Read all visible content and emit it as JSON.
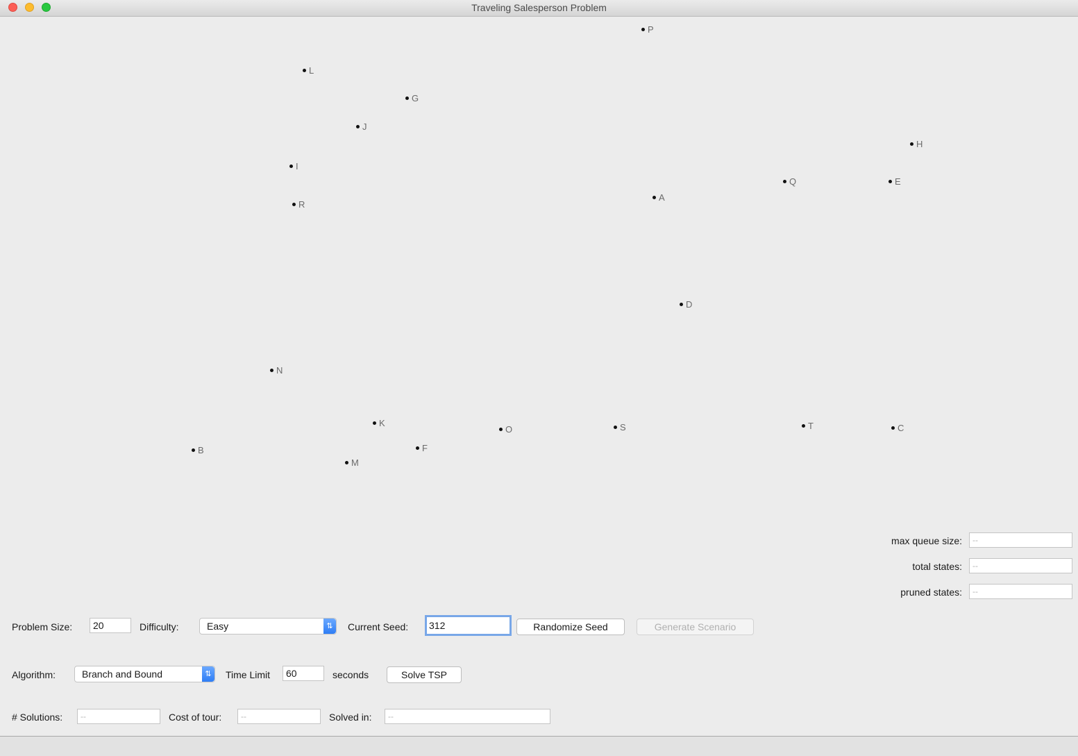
{
  "window": {
    "title": "Traveling Salesperson Problem"
  },
  "cities": [
    {
      "label": "P"
    },
    {
      "label": "L"
    },
    {
      "label": "G"
    },
    {
      "label": "J"
    },
    {
      "label": "H"
    },
    {
      "label": "I"
    },
    {
      "label": "Q"
    },
    {
      "label": "E"
    },
    {
      "label": "A"
    },
    {
      "label": "R"
    },
    {
      "label": "D"
    },
    {
      "label": "N"
    },
    {
      "label": "K"
    },
    {
      "label": "O"
    },
    {
      "label": "S"
    },
    {
      "label": "T"
    },
    {
      "label": "C"
    },
    {
      "label": "F"
    },
    {
      "label": "B"
    },
    {
      "label": "M"
    }
  ],
  "stats": {
    "max_queue_label": "max queue size:",
    "max_queue_value": "--",
    "total_states_label": "total states:",
    "total_states_value": "--",
    "pruned_states_label": "pruned states:",
    "pruned_states_value": "--"
  },
  "row1": {
    "problem_size_label": "Problem Size:",
    "problem_size_value": "20",
    "difficulty_label": "Difficulty:",
    "difficulty_value": "Easy",
    "seed_label": "Current Seed:",
    "seed_value": "312",
    "randomize_label": "Randomize Seed",
    "generate_label": "Generate Scenario"
  },
  "row2": {
    "algorithm_label": "Algorithm:",
    "algorithm_value": "Branch and Bound",
    "time_limit_label": "Time Limit",
    "time_limit_value": "60",
    "seconds_label": "seconds",
    "solve_label": "Solve TSP"
  },
  "row3": {
    "solutions_label": "# Solutions:",
    "solutions_value": "--",
    "cost_label": "Cost of tour:",
    "cost_value": "--",
    "solved_label": "Solved in:",
    "solved_value": "--"
  }
}
